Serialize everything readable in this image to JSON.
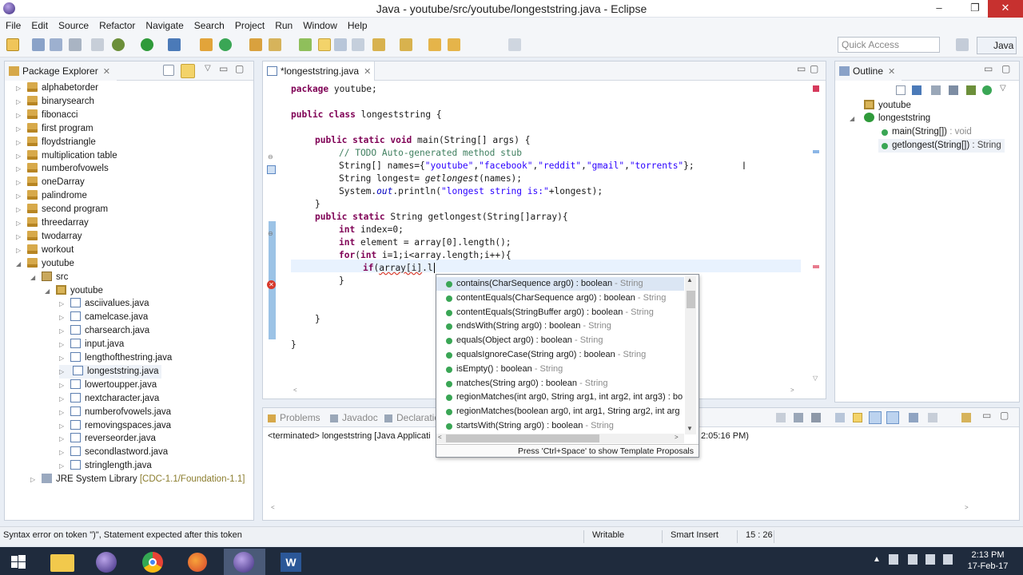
{
  "window": {
    "title": "Java - youtube/src/youtube/longeststring.java - Eclipse",
    "minimize": "–",
    "maximize": "❐",
    "close": "✕"
  },
  "menu": [
    "File",
    "Edit",
    "Source",
    "Refactor",
    "Navigate",
    "Search",
    "Project",
    "Run",
    "Window",
    "Help"
  ],
  "toolbar": {
    "quick_access_placeholder": "Quick Access",
    "perspective": "Java"
  },
  "package_explorer": {
    "title": "Package Explorer",
    "items": [
      {
        "label": "alphabetorder",
        "type": "project",
        "twisty": "▷"
      },
      {
        "label": "binarysearch",
        "type": "project",
        "twisty": "▷"
      },
      {
        "label": "fibonacci",
        "type": "project",
        "twisty": "▷"
      },
      {
        "label": "first program",
        "type": "project",
        "twisty": "▷"
      },
      {
        "label": "floydstriangle",
        "type": "project",
        "twisty": "▷"
      },
      {
        "label": "multiplication table",
        "type": "project",
        "twisty": "▷"
      },
      {
        "label": "numberofvowels",
        "type": "project",
        "twisty": "▷"
      },
      {
        "label": "oneDarray",
        "type": "project",
        "twisty": "▷"
      },
      {
        "label": "palindrome",
        "type": "project",
        "twisty": "▷"
      },
      {
        "label": "second program",
        "type": "project",
        "twisty": "▷"
      },
      {
        "label": "threedarray",
        "type": "project",
        "twisty": "▷"
      },
      {
        "label": "twodarray",
        "type": "project",
        "twisty": "▷"
      },
      {
        "label": "workout",
        "type": "project",
        "twisty": "▷"
      },
      {
        "label": "youtube",
        "type": "project",
        "twisty": "◢"
      },
      {
        "label": "src",
        "type": "src",
        "twisty": "◢"
      },
      {
        "label": "youtube",
        "type": "package",
        "twisty": "◢"
      },
      {
        "label": "asciivalues.java",
        "type": "java",
        "twisty": "▷"
      },
      {
        "label": "camelcase.java",
        "type": "java",
        "twisty": "▷"
      },
      {
        "label": "charsearch.java",
        "type": "java",
        "twisty": "▷"
      },
      {
        "label": "input.java",
        "type": "java",
        "twisty": "▷"
      },
      {
        "label": "lengthofthestring.java",
        "type": "java",
        "twisty": "▷"
      },
      {
        "label": "longeststring.java",
        "type": "java",
        "twisty": "▷",
        "selected": true
      },
      {
        "label": "lowertoupper.java",
        "type": "java",
        "twisty": "▷"
      },
      {
        "label": "nextcharacter.java",
        "type": "java",
        "twisty": "▷"
      },
      {
        "label": "numberofvowels.java",
        "type": "java",
        "twisty": "▷"
      },
      {
        "label": "removingspaces.java",
        "type": "java",
        "twisty": "▷"
      },
      {
        "label": "reverseorder.java",
        "type": "java",
        "twisty": "▷"
      },
      {
        "label": "secondlastword.java",
        "type": "java",
        "twisty": "▷"
      },
      {
        "label": "stringlength.java",
        "type": "java",
        "twisty": "▷"
      }
    ],
    "jre": {
      "label": "JRE System Library",
      "suffix": "[CDC-1.1/Foundation-1.1]",
      "twisty": "▷"
    }
  },
  "editor": {
    "tab": "*longeststring.java",
    "lines": {
      "l1": [
        "package",
        " youtube;"
      ],
      "l2": [
        "public",
        " ",
        "class",
        " longeststring {"
      ],
      "l3": [
        "public",
        " ",
        "static",
        " ",
        "void",
        " main(String[] args) {"
      ],
      "l4": "// TODO Auto-generated method stub",
      "l5": [
        "String[] names={",
        "\"youtube\"",
        ",",
        "\"facebook\"",
        ",",
        "\"reddit\"",
        ",",
        "\"gmail\"",
        ",",
        "\"torrents\"",
        "};"
      ],
      "l6": [
        "String longest= ",
        "getlongest",
        "(names);"
      ],
      "l7": [
        "System.",
        "out",
        ".println(",
        "\"longest string is:\"",
        "+longest);"
      ],
      "l8": "}",
      "l9": [
        "public",
        " ",
        "static",
        " String getlongest(String[]array){"
      ],
      "l10": [
        "int",
        " index=0;"
      ],
      "l11": [
        "int",
        " element = array[0].length();"
      ],
      "l12": [
        "for",
        "(",
        "int",
        " i=1;i<array.length;i++){"
      ],
      "l13": [
        "if",
        "(",
        "array[i]",
        ".l"
      ],
      "l14": "}",
      "l15": "}",
      "l16": "}"
    }
  },
  "completion": {
    "items": [
      {
        "sig": "contains(CharSequence arg0) : boolean",
        "type": " - String"
      },
      {
        "sig": "contentEquals(CharSequence arg0) : boolean",
        "type": " - String"
      },
      {
        "sig": "contentEquals(StringBuffer arg0) : boolean",
        "type": " - String"
      },
      {
        "sig": "endsWith(String arg0) : boolean",
        "type": " - String"
      },
      {
        "sig": "equals(Object arg0) : boolean",
        "type": " - String"
      },
      {
        "sig": "equalsIgnoreCase(String arg0) : boolean",
        "type": " - String"
      },
      {
        "sig": "isEmpty() : boolean",
        "type": " - String"
      },
      {
        "sig": "matches(String arg0) : boolean",
        "type": " - String"
      },
      {
        "sig": "regionMatches(int arg0, String arg1, int arg2, int arg3) : bo",
        "type": ""
      },
      {
        "sig": "regionMatches(boolean arg0, int arg1, String arg2, int arg",
        "type": ""
      },
      {
        "sig": "startsWith(String arg0) : boolean",
        "type": " - String"
      }
    ],
    "footer": "Press 'Ctrl+Space' to show Template Proposals"
  },
  "outline": {
    "title": "Outline",
    "package": "youtube",
    "class": "longeststring",
    "methods": [
      {
        "name": "main(String[])",
        "ret": " : void"
      },
      {
        "name": "getlongest(String[])",
        "ret": " : String"
      }
    ]
  },
  "console": {
    "tabs": [
      "Problems",
      "Javadoc",
      "Declaratio"
    ],
    "terminated_left": "<terminated> longeststring [Java Applicati",
    "terminated_right": "2:05:16 PM)"
  },
  "status": {
    "message": "Syntax error on token \")\", Statement expected after this token",
    "writable": "Writable",
    "insert": "Smart Insert",
    "position": "15 : 26"
  },
  "taskbar": {
    "time": "2:13 PM",
    "date": "17-Feb-17"
  }
}
